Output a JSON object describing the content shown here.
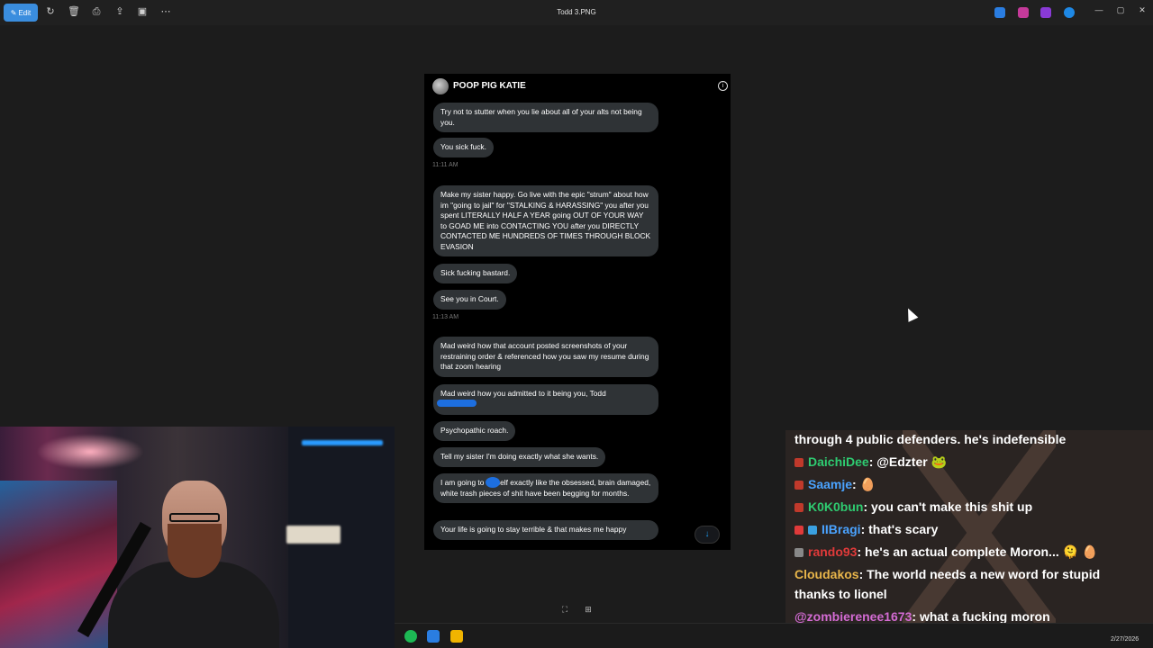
{
  "toolbar": {
    "edit_label": "Edit",
    "icons": [
      "rotate-icon",
      "delete-icon",
      "print-icon",
      "share-icon",
      "crop-icon",
      "more-icon"
    ],
    "title": "Todd 3.PNG"
  },
  "dm": {
    "contact_name": "POOP PIG KATIE",
    "messages": [
      {
        "type": "bubble",
        "text": "Try not to stutter when you lie about all of your alts not being you."
      },
      {
        "type": "bubble",
        "text": "You sick fuck."
      },
      {
        "type": "time",
        "text": "11:11 AM"
      },
      {
        "type": "bubble",
        "text": "Make my sister happy. Go live with the epic \"strum\" about how im \"going to jail\" for \"STALKING & HARASSING\" you after you spent LITERALLY HALF A YEAR going OUT OF YOUR WAY to GOAD ME into CONTACTING YOU after you DIRECTLY CONTACTED ME HUNDREDS OF TIMES THROUGH BLOCK EVASION"
      },
      {
        "type": "bubble",
        "text": "Sick fucking bastard."
      },
      {
        "type": "bubble",
        "text": "See you in Court."
      },
      {
        "type": "time",
        "text": "11:13 AM"
      },
      {
        "type": "bubble",
        "text": "Mad weird how that account posted screenshots of your restraining order & referenced how you saw my resume during that zoom hearing"
      },
      {
        "type": "bubble",
        "text": "Mad weird how you admitted to it being you, Todd"
      },
      {
        "type": "bubble",
        "text": "Psychopathic roach."
      },
      {
        "type": "bubble",
        "text": "Tell my sister I'm doing exactly what she wants."
      },
      {
        "type": "bubble",
        "text": "I am going to   myself exactly like the obsessed, brain damaged, white trash pieces of shit have been begging for months."
      },
      {
        "type": "bubble",
        "text": "Your life is going to stay terrible & that makes me happy"
      }
    ]
  },
  "chat": {
    "lines": [
      {
        "user": "",
        "user_color": "#ffffff",
        "text": "through 4 public defenders. he's indefensible"
      },
      {
        "user": "DaichiDee",
        "user_color": "#2ecc71",
        "text": ": @Edzter 🐸"
      },
      {
        "user": "Saamje",
        "user_color": "#4aa3ff",
        "text": ": 🥚"
      },
      {
        "user": "K0K0bun",
        "user_color": "#2ecc71",
        "text": ": you can't make this shit up"
      },
      {
        "user": "IIBragi",
        "user_color": "#4aa3ff",
        "text": ": that's scary"
      },
      {
        "user": "rando93",
        "user_color": "#e03a3a",
        "text": ": he's an actual complete Moron... 🫠 🥚"
      },
      {
        "user": "Cloudakos",
        "user_color": "#e8b54a",
        "text": ": The world needs a new word for stupid"
      },
      {
        "user": "",
        "user_color": "#ffffff",
        "text": "thanks to lionel"
      },
      {
        "user": "@zombierenee1673",
        "user_color": "#d36bd3",
        "text": ": what a fucking moron"
      }
    ]
  },
  "taskbar": {
    "date": "2/27/2026"
  }
}
